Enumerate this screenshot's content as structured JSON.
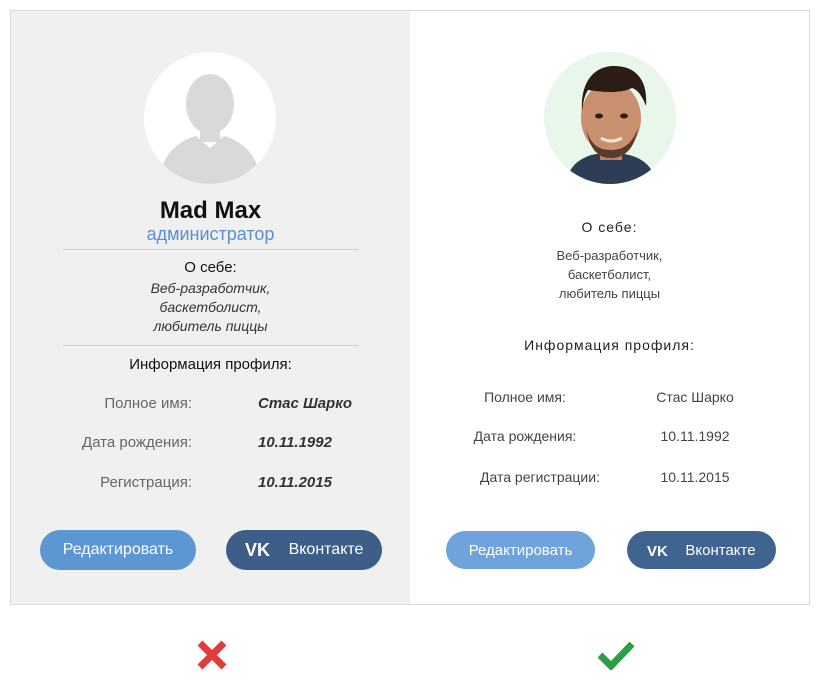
{
  "bad_example": {
    "name": "Mad Max",
    "role": "администратор",
    "about_title": "О себе:",
    "about_lines": [
      "Веб-разработчик,",
      "баскетболист,",
      "любитель пиццы"
    ],
    "info_title": "Информация профиля:",
    "rows": [
      {
        "label": "Полное имя:",
        "value": "Стас Шарко"
      },
      {
        "label": "Дата рождения:",
        "value": "10.11.1992"
      },
      {
        "label": "Регистрация:",
        "value": "10.11.2015"
      }
    ],
    "edit_button": "Редактировать",
    "vk_button": "Вконтакте"
  },
  "good_example": {
    "about_title": "О себе:",
    "about_lines": [
      "Веб-разработчик,",
      "баскетболист,",
      "любитель пиццы"
    ],
    "info_title": "Информация профиля:",
    "rows": [
      {
        "label": "Полное имя:",
        "value": "Стас Шарко"
      },
      {
        "label": "Дата рождения:",
        "value": "10.11.1992"
      },
      {
        "label": "Дата регистрации:",
        "value": "10.11.2015"
      }
    ],
    "edit_button": "Редактировать",
    "vk_button": "Вконтакте"
  },
  "icons": {
    "bad_mark": "cross-icon",
    "good_mark": "check-icon",
    "vk": "vk-logo-icon",
    "placeholder_avatar": "user-silhouette-icon"
  },
  "colors": {
    "cross": "#e23b3b",
    "check": "#2e9e45",
    "edit_button": "#5d97d3",
    "vk_button": "#3d5f87",
    "role": "#5b8fc9"
  }
}
